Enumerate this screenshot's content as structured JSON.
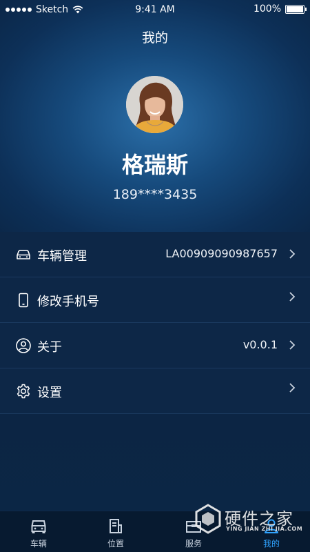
{
  "status_bar": {
    "carrier": "Sketch",
    "time": "9:41 AM",
    "battery": "100%"
  },
  "nav": {
    "title": "我的"
  },
  "profile": {
    "name": "格瑞斯",
    "phone": "189****3435"
  },
  "menu": [
    {
      "label": "车辆管理",
      "value": "LA00909090987657",
      "icon": "car-icon"
    },
    {
      "label": "修改手机号",
      "value": "",
      "icon": "phone-icon"
    },
    {
      "label": "关于",
      "value": "v0.0.1",
      "icon": "user-circle-icon"
    },
    {
      "label": "设置",
      "value": "",
      "icon": "gear-icon"
    }
  ],
  "tabs": [
    {
      "label": "车辆",
      "icon": "car-front-icon",
      "active": false
    },
    {
      "label": "位置",
      "icon": "location-icon",
      "active": false
    },
    {
      "label": "服务",
      "icon": "service-icon",
      "active": false
    },
    {
      "label": "我的",
      "icon": "person-icon",
      "active": true
    }
  ],
  "watermark": {
    "text": "硬件之家",
    "sub": "YING JIAN ZHI JIA.COM"
  },
  "colors": {
    "accent": "#2fa3ff",
    "background": "#0a2240",
    "tabbar": "#071a30"
  }
}
